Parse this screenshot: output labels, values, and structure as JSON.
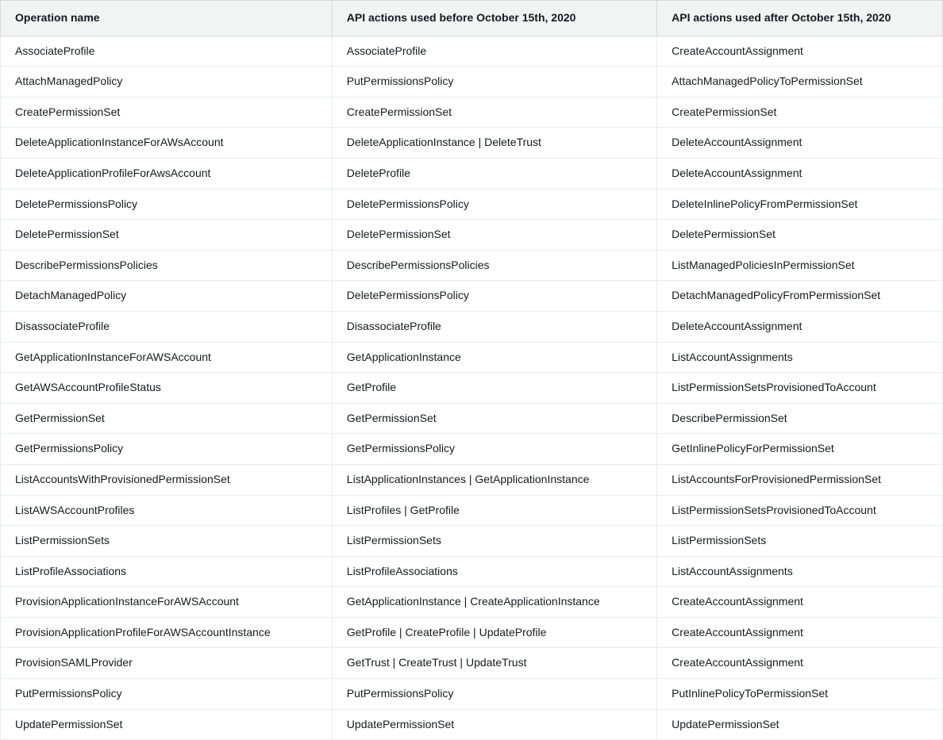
{
  "table": {
    "headers": [
      "Operation name",
      "API actions used before October 15th, 2020",
      "API actions used after October 15th, 2020"
    ],
    "rows": [
      {
        "c0": "AssociateProfile",
        "c1": "AssociateProfile",
        "c2": "CreateAccountAssignment"
      },
      {
        "c0": "AttachManagedPolicy",
        "c1": "PutPermissionsPolicy",
        "c2": "AttachManagedPolicyToPermissionSet"
      },
      {
        "c0": "CreatePermissionSet",
        "c1": "CreatePermissionSet",
        "c2": "CreatePermissionSet"
      },
      {
        "c0": "DeleteApplicationInstanceForAWsAccount",
        "c1": "DeleteApplicationInstance | DeleteTrust",
        "c2": "DeleteAccountAssignment"
      },
      {
        "c0": "DeleteApplicationProfileForAwsAccount",
        "c1": "DeleteProfile",
        "c2": "DeleteAccountAssignment"
      },
      {
        "c0": "DeletePermissionsPolicy",
        "c1": "DeletePermissionsPolicy",
        "c2": "DeleteInlinePolicyFromPermissionSet"
      },
      {
        "c0": "DeletePermissionSet",
        "c1": "DeletePermissionSet",
        "c2": "DeletePermissionSet"
      },
      {
        "c0": "DescribePermissionsPolicies",
        "c1": "DescribePermissionsPolicies",
        "c2": "ListManagedPoliciesInPermissionSet"
      },
      {
        "c0": "DetachManagedPolicy",
        "c1": "DeletePermissionsPolicy",
        "c2": "DetachManagedPolicyFromPermissionSet"
      },
      {
        "c0": "DisassociateProfile",
        "c1": "DisassociateProfile",
        "c2": "DeleteAccountAssignment"
      },
      {
        "c0": "GetApplicationInstanceForAWSAccount",
        "c1": "GetApplicationInstance",
        "c2": "ListAccountAssignments"
      },
      {
        "c0": "GetAWSAccountProfileStatus",
        "c1": "GetProfile",
        "c2": "ListPermissionSetsProvisionedToAccount"
      },
      {
        "c0": "GetPermissionSet",
        "c1": "GetPermissionSet",
        "c2": "DescribePermissionSet"
      },
      {
        "c0": "GetPermissionsPolicy",
        "c1": "GetPermissionsPolicy",
        "c2": "GetInlinePolicyForPermissionSet"
      },
      {
        "c0": "ListAccountsWithProvisionedPermissionSet",
        "c1": "ListApplicationInstances | GetApplicationInstance",
        "c2": "ListAccountsForProvisionedPermissionSet"
      },
      {
        "c0": "ListAWSAccountProfiles",
        "c1": "ListProfiles | GetProfile",
        "c2": "ListPermissionSetsProvisionedToAccount"
      },
      {
        "c0": "ListPermissionSets",
        "c1": "ListPermissionSets",
        "c2": "ListPermissionSets"
      },
      {
        "c0": "ListProfileAssociations",
        "c1": "ListProfileAssociations",
        "c2": "ListAccountAssignments"
      },
      {
        "c0": "ProvisionApplicationInstanceForAWSAccount",
        "c1": "GetApplicationInstance | CreateApplicationInstance",
        "c2": "CreateAccountAssignment"
      },
      {
        "c0": "ProvisionApplicationProfileForAWSAccountInstance",
        "c1": "GetProfile | CreateProfile | UpdateProfile",
        "c2": "CreateAccountAssignment"
      },
      {
        "c0": "ProvisionSAMLProvider",
        "c1": "GetTrust | CreateTrust | UpdateTrust",
        "c2": "CreateAccountAssignment"
      },
      {
        "c0": "PutPermissionsPolicy",
        "c1": "PutPermissionsPolicy",
        "c2": "PutInlinePolicyToPermissionSet"
      },
      {
        "c0": "UpdatePermissionSet",
        "c1": "UpdatePermissionSet",
        "c2": "UpdatePermissionSet"
      }
    ]
  }
}
